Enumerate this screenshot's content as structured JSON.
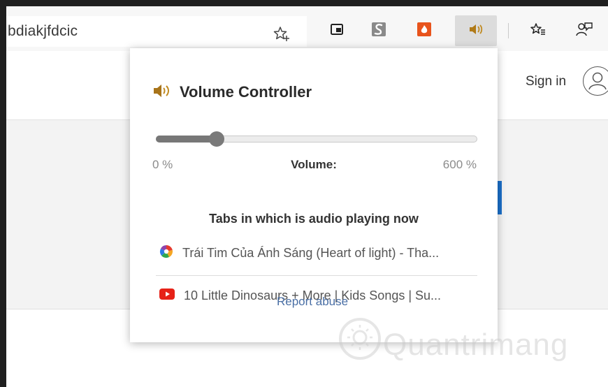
{
  "toolbar": {
    "address_text": "bdiakjfdcic",
    "icons": [
      "star-add-icon",
      "picture-in-picture-icon",
      "extension-s-icon",
      "extension-fire-icon",
      "speaker-icon",
      "favorites-icon",
      "feedback-icon"
    ]
  },
  "page": {
    "caret_text": "·",
    "sign_in_label": "Sign in"
  },
  "popup": {
    "title": "Volume Controller",
    "volume": {
      "min_label": "0 %",
      "label": "Volume:",
      "max_label": "600 %",
      "level_fraction": 0.19
    },
    "tabs_heading": "Tabs in which is audio playing now",
    "tabs": [
      {
        "title": "Trái Tim Của Ánh Sáng (Heart of light) - Tha...",
        "icon": "colorful-pinwheel-icon"
      },
      {
        "title": "10 Little Dinosaurs + More | Kids Songs | Su...",
        "icon": "youtube-icon"
      }
    ],
    "report_label": "Report abuse"
  },
  "watermark": {
    "text": "Quantrimang"
  },
  "colors": {
    "accent_blue": "#1a6fc9",
    "youtube_red": "#e62117",
    "fire_orange": "#e8541c"
  }
}
